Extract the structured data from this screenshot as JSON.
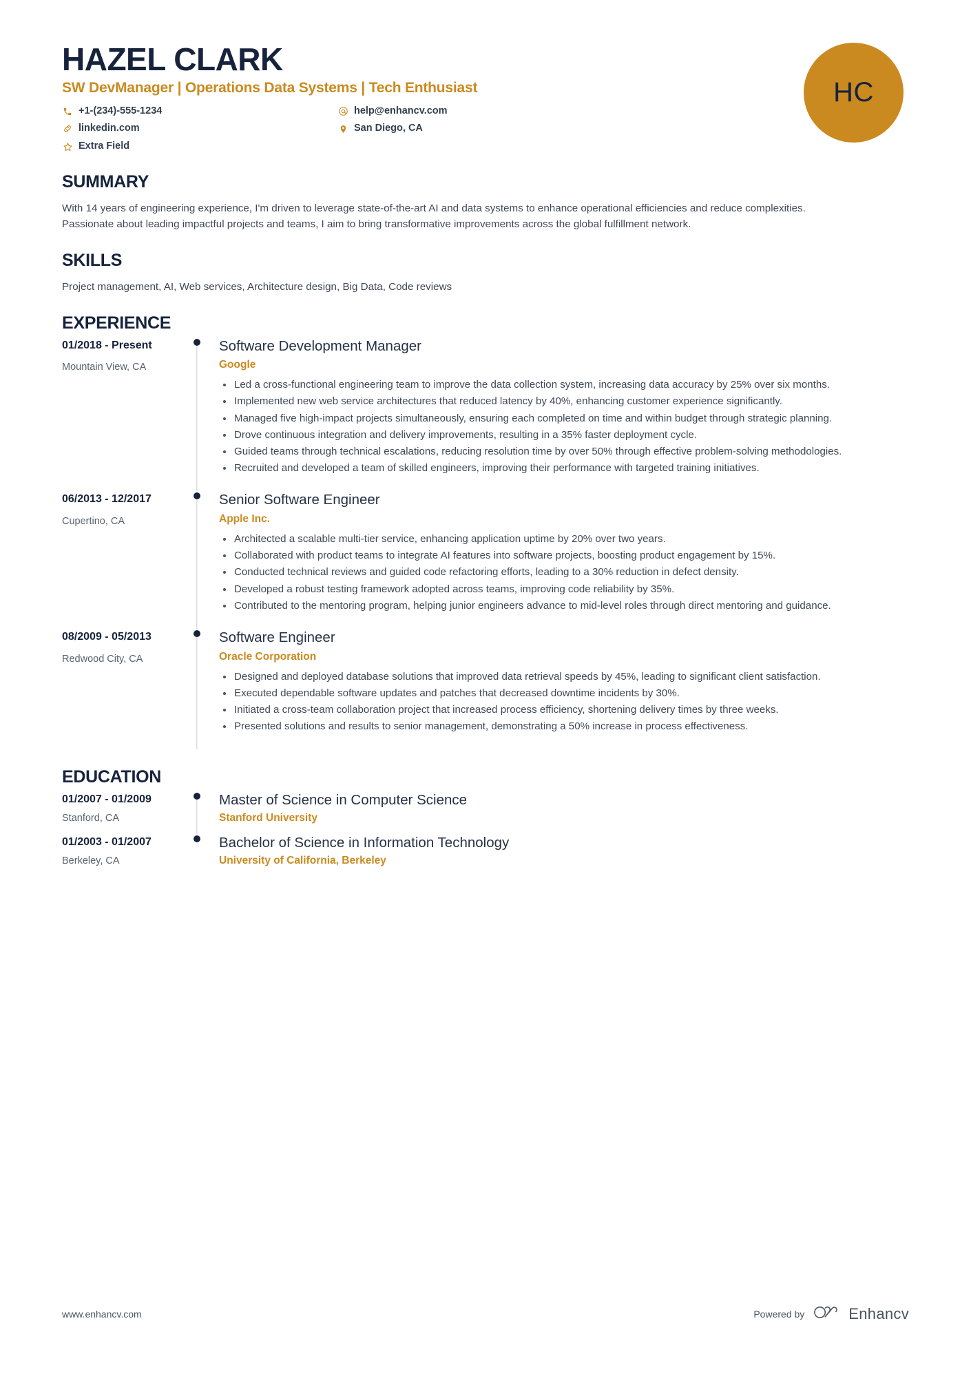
{
  "header": {
    "name": "HAZEL CLARK",
    "headline": "SW DevManager | Operations Data Systems | Tech Enthusiast",
    "avatar_initials": "HC",
    "accent_color": "#CA8A20",
    "heading_color": "#17233C",
    "contacts": [
      {
        "icon": "phone-icon",
        "value": "+1-(234)-555-1234"
      },
      {
        "icon": "email-icon",
        "value": "help@enhancv.com"
      },
      {
        "icon": "link-icon",
        "value": "linkedin.com"
      },
      {
        "icon": "location-icon",
        "value": "San Diego, CA"
      },
      {
        "icon": "star-icon",
        "value": "Extra Field"
      }
    ]
  },
  "summary": {
    "title": "SUMMARY",
    "text": "With 14 years of engineering experience, I'm driven to leverage state-of-the-art AI and data systems to enhance operational efficiencies and reduce complexities. Passionate about leading impactful projects and teams, I aim to bring transformative improvements across the global fulfillment network."
  },
  "skills": {
    "title": "SKILLS",
    "text": "Project management, AI, Web services, Architecture design, Big Data, Code reviews"
  },
  "experience": {
    "title": "EXPERIENCE",
    "entries": [
      {
        "date": "01/2018 - Present",
        "location": "Mountain View, CA",
        "role": "Software Development Manager",
        "company": "Google",
        "bullets": [
          "Led a cross-functional engineering team to improve the data collection system, increasing data accuracy by 25% over six months.",
          "Implemented new web service architectures that reduced latency by 40%, enhancing customer experience significantly.",
          "Managed five high-impact projects simultaneously, ensuring each completed on time and within budget through strategic planning.",
          "Drove continuous integration and delivery improvements, resulting in a 35% faster deployment cycle.",
          "Guided teams through technical escalations, reducing resolution time by over 50% through effective problem-solving methodologies.",
          "Recruited and developed a team of skilled engineers, improving their performance with targeted training initiatives."
        ]
      },
      {
        "date": "06/2013 - 12/2017",
        "location": "Cupertino, CA",
        "role": "Senior Software Engineer",
        "company": "Apple Inc.",
        "bullets": [
          "Architected a scalable multi-tier service, enhancing application uptime by 20% over two years.",
          "Collaborated with product teams to integrate AI features into software projects, boosting product engagement by 15%.",
          "Conducted technical reviews and guided code refactoring efforts, leading to a 30% reduction in defect density.",
          "Developed a robust testing framework adopted across teams, improving code reliability by 35%.",
          "Contributed to the mentoring program, helping junior engineers advance to mid-level roles through direct mentoring and guidance."
        ]
      },
      {
        "date": "08/2009 - 05/2013",
        "location": "Redwood City, CA",
        "role": "Software Engineer",
        "company": "Oracle Corporation",
        "bullets": [
          "Designed and deployed database solutions that improved data retrieval speeds by 45%, leading to significant client satisfaction.",
          "Executed dependable software updates and patches that decreased downtime incidents by 30%.",
          "Initiated a cross-team collaboration project that increased process efficiency, shortening delivery times by three weeks.",
          "Presented solutions and results to senior management, demonstrating a 50% increase in process effectiveness."
        ]
      }
    ]
  },
  "education": {
    "title": "EDUCATION",
    "entries": [
      {
        "date": "01/2007 - 01/2009",
        "location": "Stanford, CA",
        "degree": "Master of Science in Computer Science",
        "school": "Stanford University"
      },
      {
        "date": "01/2003 - 01/2007",
        "location": "Berkeley, CA",
        "degree": "Bachelor of Science in Information Technology",
        "school": "University of California, Berkeley"
      }
    ]
  },
  "footer": {
    "url": "www.enhancv.com",
    "powered_by": "Powered by",
    "brand": "Enhancv"
  }
}
